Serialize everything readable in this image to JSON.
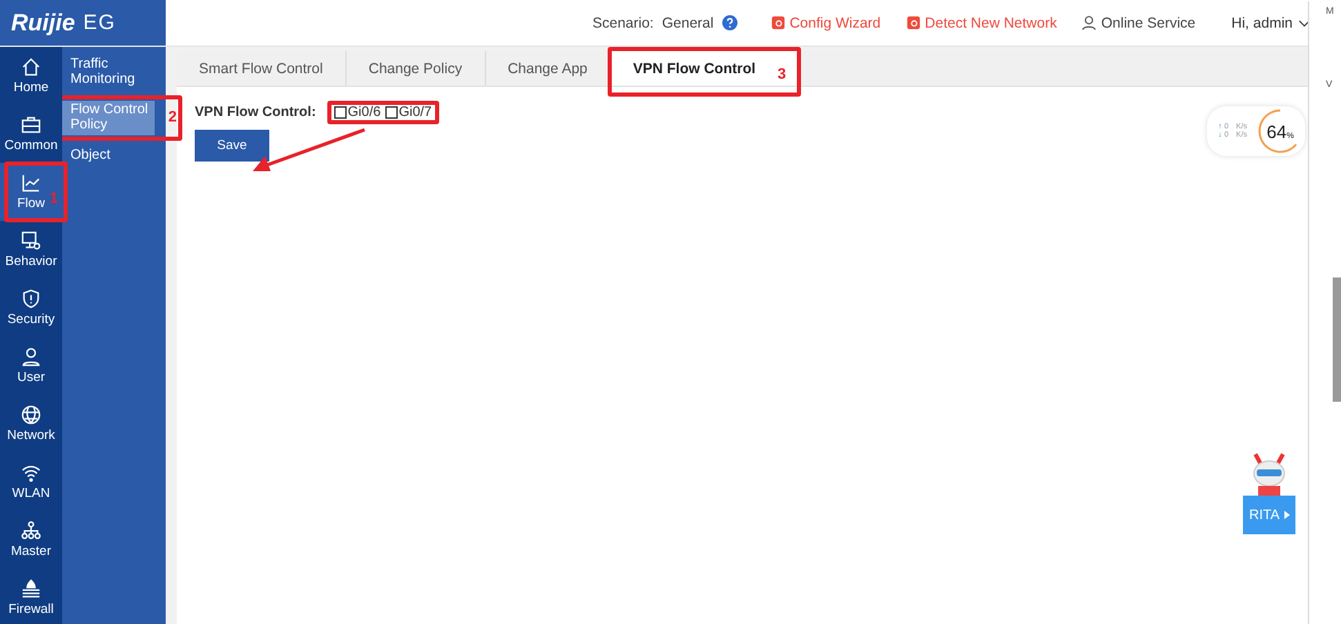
{
  "brand": {
    "logo": "Ruijie",
    "product": "EG"
  },
  "header": {
    "scenario_label": "Scenario:",
    "scenario_value": "General",
    "links": [
      {
        "label": "Config Wizard",
        "kind": "wizard"
      },
      {
        "label": "Detect New Network",
        "kind": "detect"
      },
      {
        "label": "Online Service",
        "kind": "service"
      }
    ],
    "user": "Hi, admin"
  },
  "rail": [
    {
      "label": "Home",
      "selected": false
    },
    {
      "label": "Common",
      "selected": false
    },
    {
      "label": "Flow",
      "selected": true,
      "annotation": "1"
    },
    {
      "label": "Behavior",
      "selected": false
    },
    {
      "label": "Security",
      "selected": false
    },
    {
      "label": "User",
      "selected": false
    },
    {
      "label": "Network",
      "selected": false
    },
    {
      "label": "WLAN",
      "selected": false
    },
    {
      "label": "Master",
      "selected": false
    },
    {
      "label": "Firewall",
      "selected": false
    }
  ],
  "submenu": [
    {
      "label": "Traffic Monitoring",
      "selected": false
    },
    {
      "label": "Flow Control Policy",
      "selected": true,
      "annotation": "2"
    },
    {
      "label": "Object",
      "selected": false
    }
  ],
  "tabs": [
    {
      "label": "Smart Flow Control",
      "selected": false
    },
    {
      "label": "Change Policy",
      "selected": false
    },
    {
      "label": "Change App",
      "selected": false
    },
    {
      "label": "VPN Flow Control",
      "selected": true,
      "annotation": "3"
    }
  ],
  "form": {
    "label": "VPN Flow Control:",
    "interfaces": [
      {
        "label": "Gi0/6",
        "checked": false
      },
      {
        "label": "Gi0/7",
        "checked": false
      }
    ],
    "highlighted": true,
    "arrow_to_save": true,
    "save": "Save"
  },
  "speed": {
    "up_arrow": "↑",
    "up": "0",
    "up_unit": "K/s",
    "down_arrow": "↓",
    "down": "0",
    "down_unit": "K/s",
    "reading": "64",
    "unit": "%"
  },
  "assistant": {
    "label": "RITA"
  },
  "side_panel": {
    "texts": [
      "M",
      "V"
    ]
  }
}
